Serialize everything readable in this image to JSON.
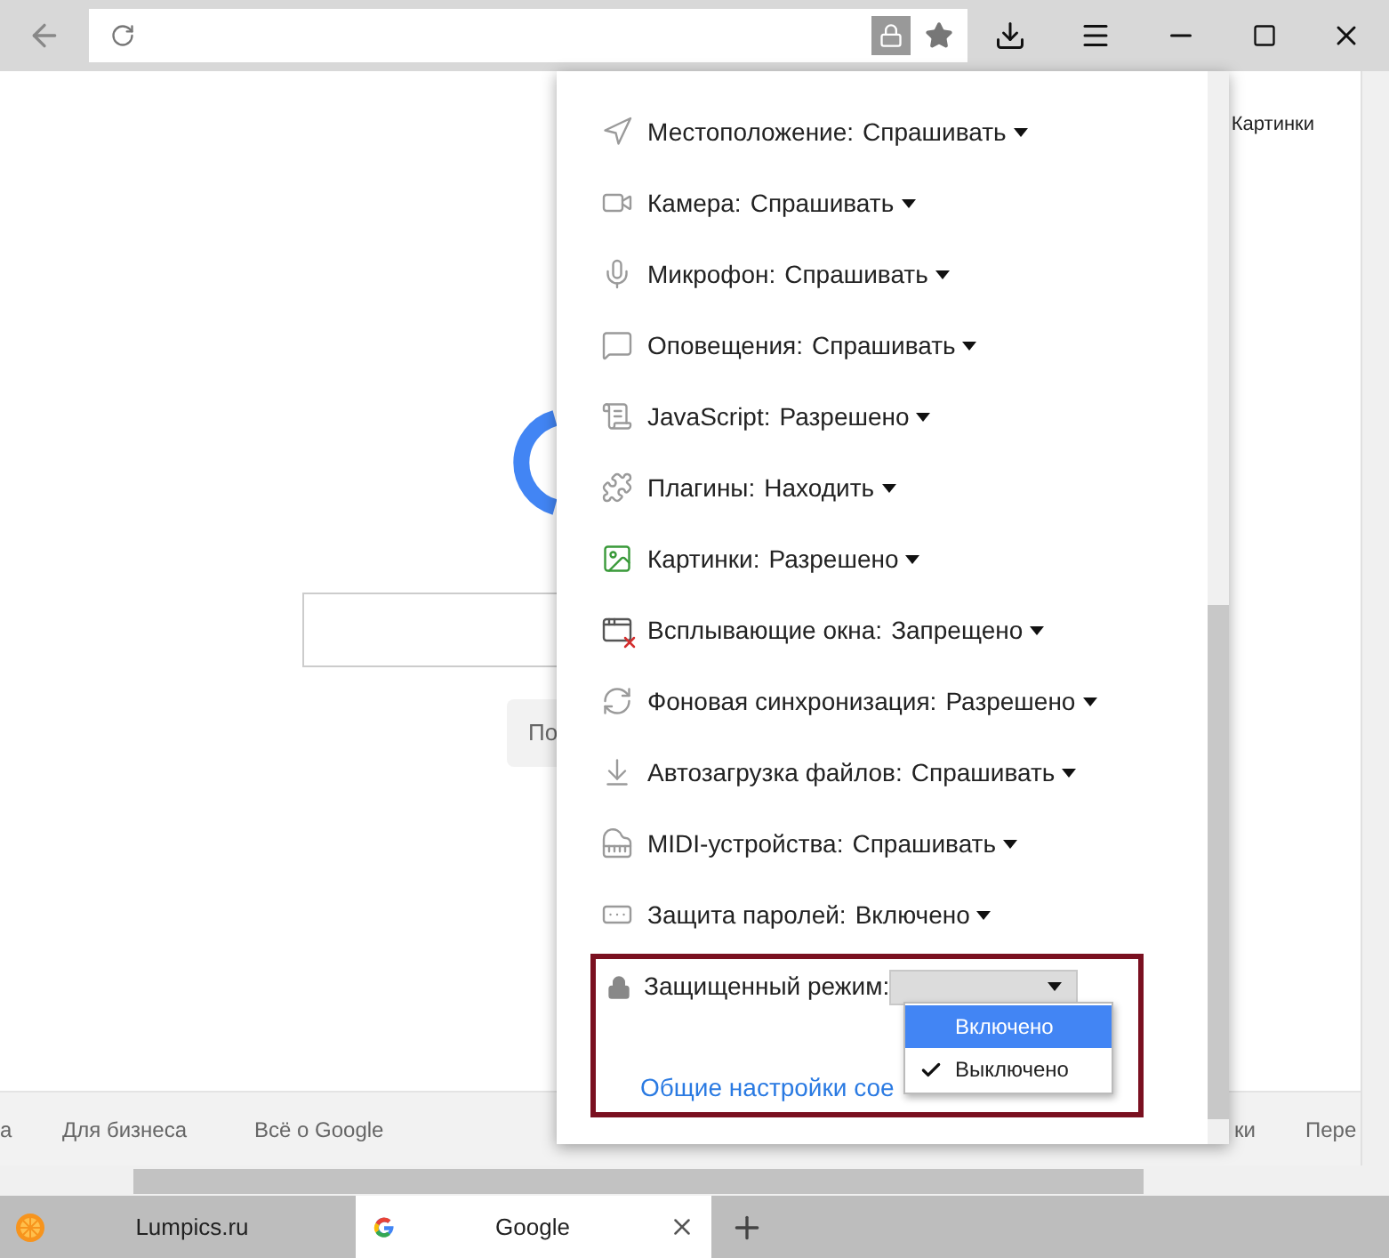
{
  "page": {
    "images_link": "Картинки",
    "search_button": "По",
    "footer_links": [
      "а",
      "Для бизнеса",
      "Всё о Google",
      "ки",
      "Пере"
    ]
  },
  "panel": {
    "permissions": [
      {
        "kind": "location",
        "label": "Местоположение:",
        "value": "Спрашивать"
      },
      {
        "kind": "camera",
        "label": "Камера:",
        "value": "Спрашивать"
      },
      {
        "kind": "microphone",
        "label": "Микрофон:",
        "value": "Спрашивать"
      },
      {
        "kind": "notifications",
        "label": "Оповещения:",
        "value": "Спрашивать"
      },
      {
        "kind": "javascript",
        "label": "JavaScript:",
        "value": "Разрешено"
      },
      {
        "kind": "plugins",
        "label": "Плагины:",
        "value": "Находить"
      },
      {
        "kind": "images",
        "label": "Картинки:",
        "value": "Разрешено"
      },
      {
        "kind": "popups",
        "label": "Всплывающие окна:",
        "value": "Запрещено"
      },
      {
        "kind": "sync",
        "label": "Фоновая синхронизация:",
        "value": "Разрешено"
      },
      {
        "kind": "downloads",
        "label": "Автозагрузка файлов:",
        "value": "Спрашивать"
      },
      {
        "kind": "midi",
        "label": "MIDI-устройства:",
        "value": "Спрашивать"
      },
      {
        "kind": "passwords",
        "label": "Защита паролей:",
        "value": "Включено"
      }
    ],
    "protected_mode": {
      "label": "Защищенный режим:",
      "options": [
        {
          "label": "Включено",
          "selected": true,
          "checked": false
        },
        {
          "label": "Выключено",
          "selected": false,
          "checked": true
        }
      ]
    },
    "settings_link": "Общие настройки сое"
  },
  "tabs": [
    {
      "title": "Lumpics.ru",
      "selected": false,
      "kind": "lumpics"
    },
    {
      "title": "Google",
      "selected": true,
      "kind": "google"
    }
  ]
}
